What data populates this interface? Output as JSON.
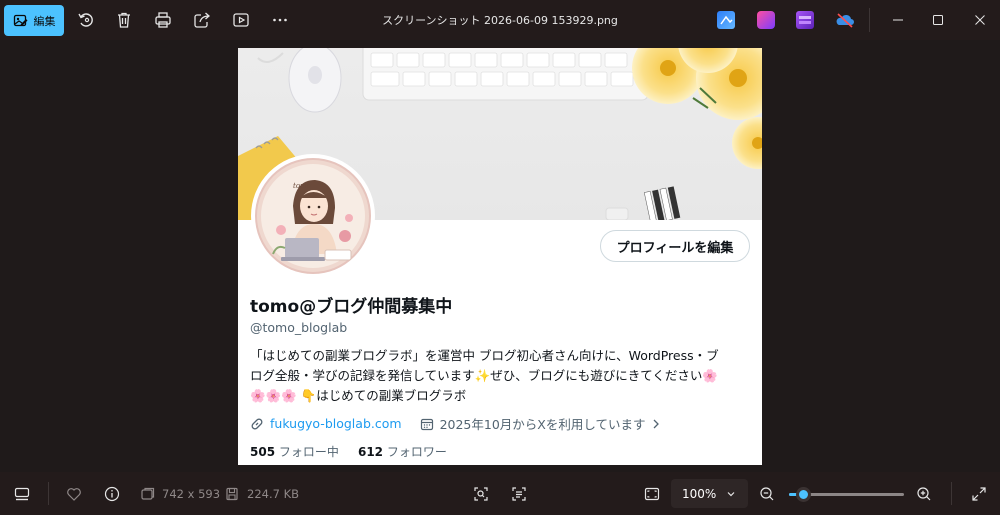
{
  "toolbar": {
    "edit_label": "編集",
    "title": "スクリーンショット 2026-06-09 153929.png"
  },
  "profile": {
    "name": "tomo@ブログ仲間募集中",
    "handle": "@tomo_bloglab",
    "edit_profile_label": "プロフィールを編集",
    "bio_line1": "「はじめての副業ブログラボ」を運営中 ブログ初心者さん向けに、WordPress・ブ",
    "bio_line2": "ログ全般・学びの記録を発信しています✨ぜひ、ブログにも遊びにきてください🌸",
    "bio_line3": "🌸🌸🌸 👇はじめての副業ブログラボ",
    "link": "fukugyo-bloglab.com",
    "joined": "2025年10月からXを利用しています",
    "following_count": "505",
    "following_label": "フォロー中",
    "followers_count": "612",
    "followers_label": "フォロワー",
    "avatar_text": "tomo"
  },
  "status": {
    "dimensions": "742 x 593",
    "file_size": "224.7 KB",
    "zoom": "100%",
    "zoom_level": 0.12
  },
  "colors": {
    "accent": "#4cc2ff",
    "x_link": "#1d9bf0"
  }
}
